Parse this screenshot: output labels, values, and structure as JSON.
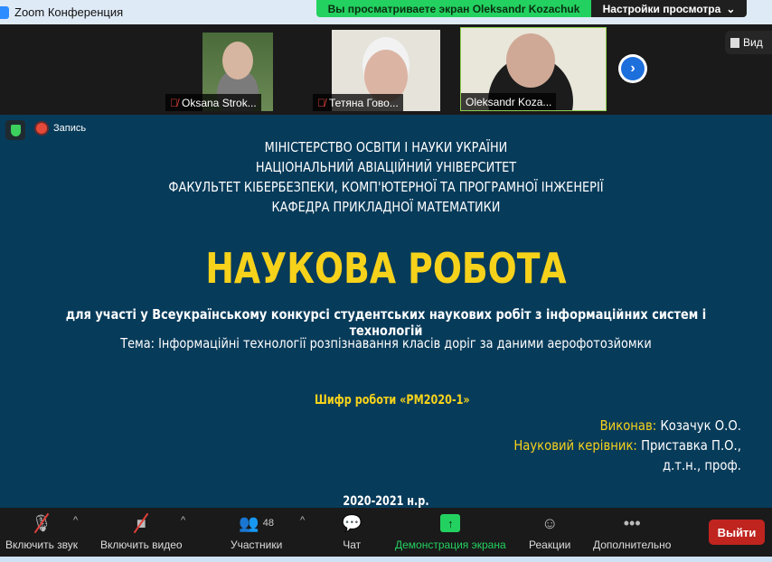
{
  "window": {
    "title": "Zoom Конференция"
  },
  "banner": {
    "viewing": "Вы просматриваете экран Oleksandr Kozachuk",
    "view_options": "Настройки просмотра",
    "view_button": "Вид"
  },
  "participants": [
    {
      "name": "Oksana Strok..."
    },
    {
      "name": "Тетяна Гово..."
    },
    {
      "name": "Oleksandr Koza..."
    }
  ],
  "recording": {
    "label": "Запись"
  },
  "slide": {
    "header": [
      "МІНІСТЕРСТВО ОСВІТИ І НАУКИ УКРАЇНИ",
      "НАЦІОНАЛЬНИЙ АВІАЦІЙНИЙ УНІВЕРСИТЕТ",
      "ФАКУЛЬТЕТ КІБЕРБЕЗПЕКИ, КОМП'ЮТЕРНОЇ ТА ПРОГРАМНОЇ ІНЖЕНЕРІЇ",
      "КАФЕДРА ПРИКЛАДНОЇ МАТЕМАТИКИ"
    ],
    "title": "НАУКОВА РОБОТА",
    "subtitle": "для участі у Всеукраїнському конкурсі студентських наукових робіт з інформаційних систем і технологій",
    "theme": "Тема: Інформаційні технології розпізнавання класів доріг за даними аерофотозйомки",
    "cipher": "Шифр роботи «РМ2020-1»",
    "author_label": "Виконав:",
    "author": "Козачук О.О.",
    "supervisor_label": "Науковий керівник:",
    "supervisor": "Приставка П.О.,",
    "supervisor_title": "д.т.н., проф.",
    "year": "2020-2021 н.р."
  },
  "toolbar": {
    "audio": "Включить звук",
    "video": "Включить видео",
    "participants": "Участники",
    "participants_count": "48",
    "chat": "Чат",
    "share": "Демонстрация экрана",
    "reactions": "Реакции",
    "more": "Дополнительно",
    "leave": "Выйти"
  }
}
